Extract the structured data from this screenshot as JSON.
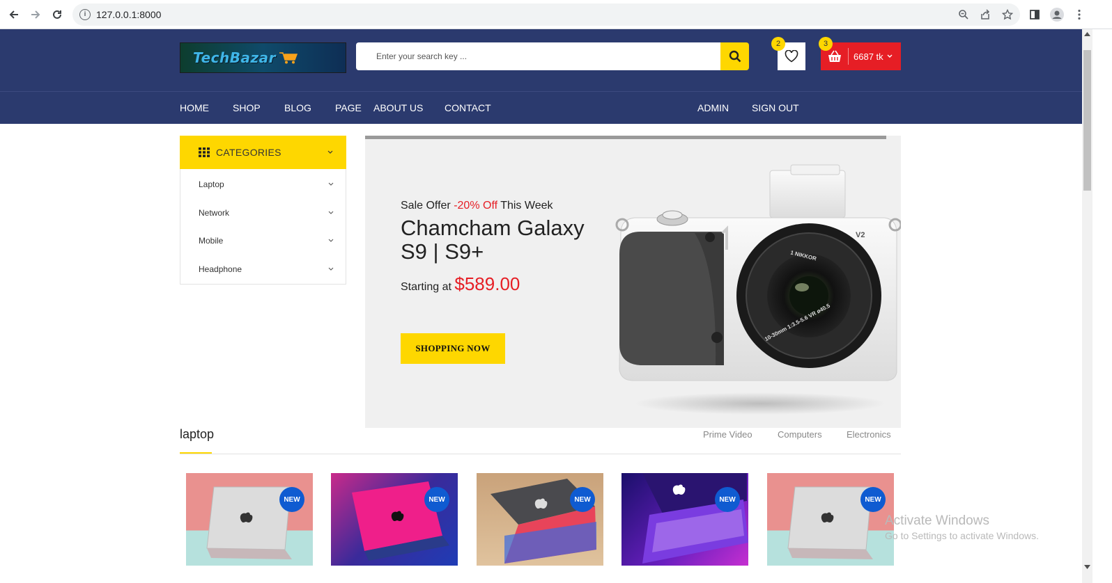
{
  "browser": {
    "url": "127.0.0.1:8000"
  },
  "header": {
    "logo_text": "TechBazar",
    "search_placeholder": "Enter your search key ...",
    "wishlist_count": "2",
    "cart_count": "3",
    "cart_amount": "6687 tk"
  },
  "nav": {
    "items": [
      "HOME",
      "SHOP",
      "BLOG",
      "PAGE",
      "ABOUT US",
      "CONTACT"
    ],
    "right": [
      "ADMIN",
      "SIGN OUT"
    ]
  },
  "categories": {
    "title": "CATEGORIES",
    "items": [
      "Laptop",
      "Network",
      "Mobile",
      "Headphone"
    ]
  },
  "banner": {
    "offer_prefix": "Sale Offer",
    "offer_pct": "-20% Off",
    "offer_suffix": "This Week",
    "title": "Chamcham Galaxy S9 | S9+",
    "start_prefix": "Starting at",
    "price": "$589.00",
    "button": "SHOPPING NOW",
    "camera_model": "V2",
    "lens_brand": "1 NIKKOR",
    "lens_spec": "10-30mm 1:3.5-5.6 VR ø40.5"
  },
  "section": {
    "title": "laptop",
    "tabs": [
      "Prime Video",
      "Computers",
      "Electronics"
    ],
    "badge": "NEW"
  },
  "watermark": {
    "line1": "Activate Windows",
    "line2": "Go to Settings to activate Windows."
  },
  "colors": {
    "brand_navy": "#2b3a6e",
    "accent_yellow": "#fed700",
    "sale_red": "#e61e25",
    "badge_blue": "#0f5bd1"
  }
}
